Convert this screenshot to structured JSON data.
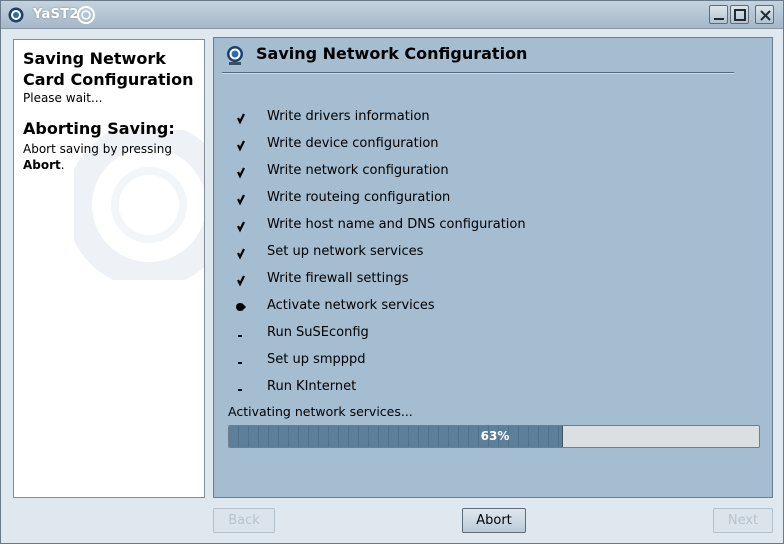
{
  "window": {
    "title": "YaST2"
  },
  "help": {
    "title": "Saving Network Card Configuration",
    "wait": "Please wait...",
    "subtitle": "Aborting Saving:",
    "body_prefix": "Abort saving by pressing ",
    "body_bold": "Abort",
    "body_suffix": "."
  },
  "content": {
    "title": "Saving Network Configuration",
    "steps": [
      {
        "label": "Write drivers information",
        "state": "done"
      },
      {
        "label": "Write device configuration",
        "state": "done"
      },
      {
        "label": "Write network configuration",
        "state": "done"
      },
      {
        "label": "Write routeing configuration",
        "state": "done"
      },
      {
        "label": "Write host name and DNS configuration",
        "state": "done"
      },
      {
        "label": "Set up network services",
        "state": "done"
      },
      {
        "label": "Write firewall settings",
        "state": "done"
      },
      {
        "label": "Activate network services",
        "state": "current"
      },
      {
        "label": "Run SuSEconfig",
        "state": "pending"
      },
      {
        "label": "Set up smpppd",
        "state": "pending"
      },
      {
        "label": "Run KInternet",
        "state": "pending"
      }
    ],
    "status": "Activating network services...",
    "progress_percent": 63,
    "progress_label": "63%"
  },
  "buttons": {
    "back": "Back",
    "abort": "Abort",
    "next": "Next"
  },
  "colors": {
    "panel": "#a5bdd0",
    "progress_fill": "#5e7f9a",
    "background": "#dfe8ef"
  },
  "icons": {
    "app": "yast-icon",
    "done": "check-icon",
    "current": "arrow-icon",
    "pending": "dash-icon"
  }
}
